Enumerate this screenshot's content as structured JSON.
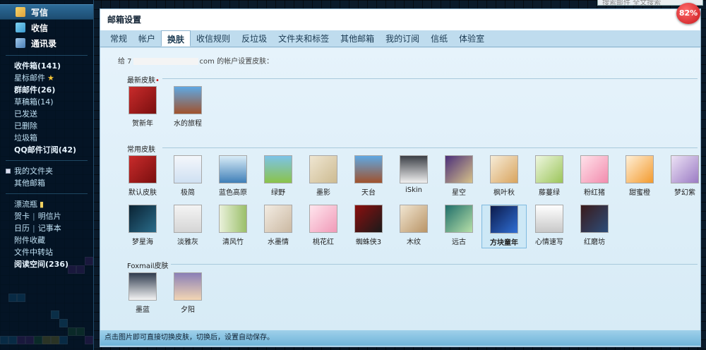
{
  "sidebar": {
    "actions": [
      {
        "label": "写信",
        "icon": "pencil-icon"
      },
      {
        "label": "收信",
        "icon": "inbox-icon"
      },
      {
        "label": "通讯录",
        "icon": "contacts-icon"
      }
    ],
    "folders": [
      {
        "label": "收件箱(141)",
        "bold": true
      },
      {
        "label": "星标邮件",
        "star": true
      },
      {
        "label": "群邮件(26)",
        "bold": true
      },
      {
        "label": "草稿箱(14)"
      },
      {
        "label": "已发送"
      },
      {
        "label": "已删除"
      },
      {
        "label": "垃圾箱"
      },
      {
        "label": "QQ邮件订阅(42)",
        "bold": true
      }
    ],
    "my_folders": "我的文件夹",
    "other_mailboxes": "其他邮箱",
    "drift_bottle": "漂流瓶",
    "greeting_card": "贺卡",
    "postcard": "明信片",
    "calendar": "日历",
    "notes": "记事本",
    "attachments": "附件收藏",
    "file_transfer": "文件中转站",
    "reading_space": "阅读空间(236)"
  },
  "search": {
    "placeholder": "搜索邮件 全文搜索"
  },
  "badge": "82%",
  "panel": {
    "title": "邮箱设置",
    "tabs": [
      "常规",
      "帐户",
      "换肤",
      "收信规则",
      "反垃圾",
      "文件夹和标签",
      "其他邮箱",
      "我的订阅",
      "信纸",
      "体验室"
    ],
    "active_tab": 2,
    "intro_prefix": "给 7",
    "intro_suffix": "com 的帐户设置皮肤：",
    "sections": {
      "newest": "最新皮肤",
      "common": "常用皮肤",
      "foxmail": "Foxmail皮肤"
    },
    "newest_skins": [
      "贺新年",
      "水的旅程"
    ],
    "common_skins_row1": [
      "默认皮肤",
      "极简",
      "蓝色高原",
      "绿野",
      "墨影",
      "天台",
      "iSkin",
      "星空",
      "枫叶秋",
      "藤蔓绿",
      "粉红猪",
      "甜蜜橙",
      "梦幻紫"
    ],
    "common_skins_row2": [
      "梦星海",
      "淡雅灰",
      "清风竹",
      "水墨情",
      "桃花红",
      "蜘蛛侠3",
      "木纹",
      "远古",
      "方块童年",
      "心情速写",
      "红磨坊"
    ],
    "selected_skin": "方块童年",
    "foxmail_skins": [
      "墨蓝",
      "夕阳"
    ],
    "footer": "点击图片即可直接切换皮肤，切换后，设置自动保存。"
  },
  "colors": {
    "accent": "#2c6b98",
    "panel_bg": "#cfe6f3",
    "badge": "#c8161b"
  }
}
